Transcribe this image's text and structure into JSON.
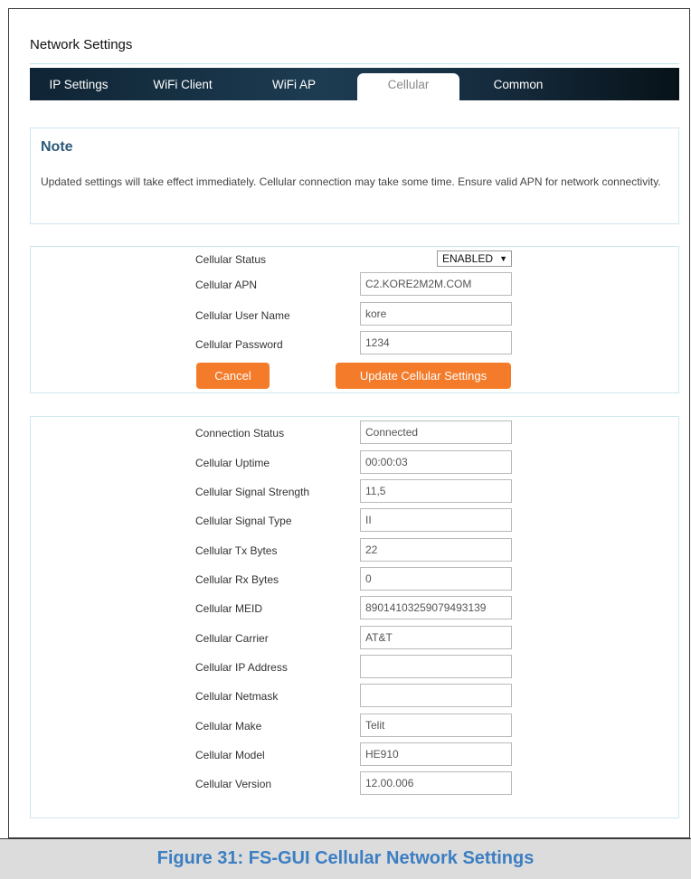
{
  "header": {
    "title": "Network Settings"
  },
  "tabs": [
    {
      "label": "IP Settings"
    },
    {
      "label": "WiFi Client"
    },
    {
      "label": "WiFi AP"
    },
    {
      "label": "Cellular"
    },
    {
      "label": "Common"
    }
  ],
  "active_tab": "Cellular",
  "note": {
    "title": "Note",
    "text": "Updated settings will take effect immediately. Cellular connection may take some time. Ensure valid APN for network connectivity."
  },
  "form": {
    "status_label": "Cellular Status",
    "status_value": "ENABLED",
    "apn_label": "Cellular APN",
    "apn_value": "C2.KORE2M2M.COM",
    "username_label": "Cellular User Name",
    "username_value": "kore",
    "password_label": "Cellular Password",
    "password_value": "1234",
    "cancel_label": "Cancel",
    "update_label": "Update Cellular Settings"
  },
  "status": {
    "rows": [
      {
        "label": "Connection Status",
        "value": "Connected"
      },
      {
        "label": "Cellular Uptime",
        "value": "00:00:03"
      },
      {
        "label": "Cellular Signal Strength",
        "value": "11,5"
      },
      {
        "label": "Cellular Signal Type",
        "value": "II"
      },
      {
        "label": "Cellular Tx Bytes",
        "value": "22"
      },
      {
        "label": "Cellular Rx Bytes",
        "value": "0"
      },
      {
        "label": "Cellular MEID",
        "value": "89014103259079493139"
      },
      {
        "label": "Cellular Carrier",
        "value": "AT&T"
      },
      {
        "label": "Cellular IP Address",
        "value": ""
      },
      {
        "label": "Cellular Netmask",
        "value": ""
      },
      {
        "label": "Cellular Make",
        "value": "Telit"
      },
      {
        "label": "Cellular Model",
        "value": "HE910"
      },
      {
        "label": "Cellular Version",
        "value": "12.00.006"
      }
    ]
  },
  "caption": "Figure 31: FS-GUI Cellular Network Settings",
  "colors": {
    "accent_button": "#f47b2a",
    "tab_bar": "#1d3c52",
    "note_title": "#2c5a7a",
    "caption": "#3c7ec2"
  }
}
